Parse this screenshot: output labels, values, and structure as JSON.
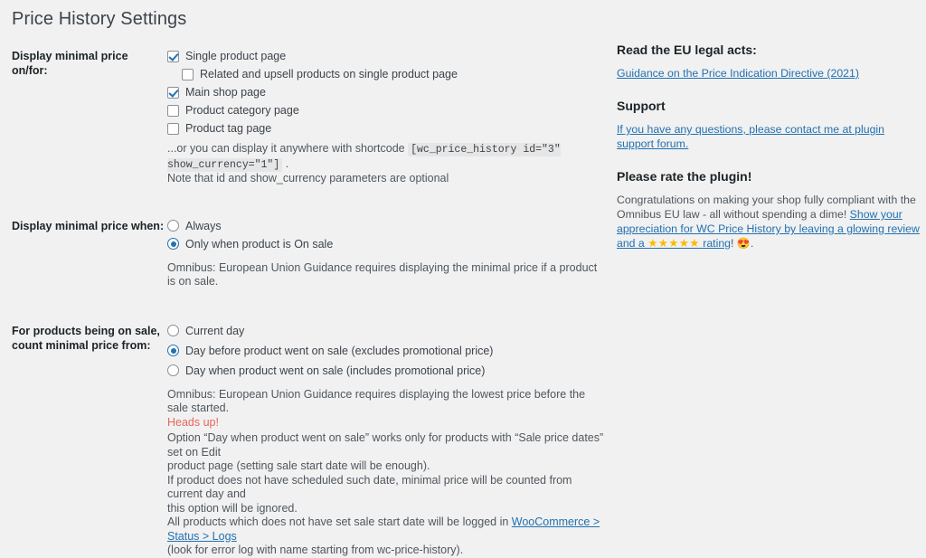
{
  "page": {
    "title": "Price History Settings"
  },
  "settings": {
    "groups": [
      {
        "label_line1": "Display minimal price on/for:",
        "label_line2": "",
        "options": [
          {
            "type": "checkbox",
            "checked": true,
            "indent": false,
            "label": "Single product page"
          },
          {
            "type": "checkbox",
            "checked": false,
            "indent": true,
            "label": "Related and upsell products on single product page"
          },
          {
            "type": "checkbox",
            "checked": true,
            "indent": false,
            "label": "Main shop page"
          },
          {
            "type": "checkbox",
            "checked": false,
            "indent": false,
            "label": "Product category page"
          },
          {
            "type": "checkbox",
            "checked": false,
            "indent": false,
            "label": "Product tag page"
          }
        ],
        "shortcode_prefix": "...or you can display it anywhere with shortcode ",
        "shortcode": "[wc_price_history id=\"3\" show_currency=\"1\"]",
        "shortcode_suffix": " .",
        "shortcode_note": "Note that id and show_currency parameters are optional"
      },
      {
        "label_line1": "Display minimal price when:",
        "label_line2": "",
        "options": [
          {
            "type": "radio",
            "checked": false,
            "indent": false,
            "label": "Always"
          },
          {
            "type": "radio",
            "checked": true,
            "indent": false,
            "label": "Only when product is On sale"
          }
        ],
        "description": "Omnibus: European Union Guidance requires displaying the minimal price if a product is on sale."
      },
      {
        "label_line1": "For products being on sale,",
        "label_line2": "count minimal price from:",
        "options": [
          {
            "type": "radio",
            "checked": false,
            "indent": false,
            "label": "Current day"
          },
          {
            "type": "radio",
            "checked": true,
            "indent": false,
            "label": "Day before product went on sale (excludes promotional price)"
          },
          {
            "type": "radio",
            "checked": false,
            "indent": false,
            "label": "Day when product went on sale (includes promotional price)"
          }
        ],
        "description": "Omnibus: European Union Guidance requires displaying the lowest price before the sale started.",
        "heads_up": "Heads up!",
        "note_line1": "Option “Day when product went on sale” works only for products with “Sale price dates” set on Edit",
        "note_line2": "product page (setting sale start date will be enough).",
        "note_line3": "If product does not have scheduled such date, minimal price will be counted from current day and",
        "note_line4": "this option will be ignored.",
        "note_line5_pre": "All products which does not have set sale start date will be logged in ",
        "note_link": "WooCommerce > Status > Logs",
        "note_line6": "(look for error log with name starting from wc-price-history)."
      }
    ]
  },
  "sidebar": {
    "legal_heading": "Read the EU legal acts:",
    "legal_link": "Guidance on the Price Indication Directive (2021)",
    "support_heading": "Support",
    "support_link": "If you have any questions, please contact me at plugin support forum.",
    "rate_heading": "Please rate the plugin!",
    "rate_text_pre": "Congratulations on making your shop fully compliant with the Omnibus EU law - all without spending a dime! ",
    "rate_link_part1": "Show your appreciation for WC Price History by leaving a glowing review and a ",
    "rate_stars": "★★★★★",
    "rate_link_part2": " rating",
    "rate_text_post": "! ",
    "rate_emoji": "😍",
    "rate_text_end": "."
  },
  "colors": {
    "background": "#f1f1f1",
    "link": "#2271b1",
    "accent_checked": "#2271b1",
    "warning": "#e8675a",
    "star": "#ffb900",
    "heading": "#1d2327",
    "body_text": "#3c434a"
  }
}
